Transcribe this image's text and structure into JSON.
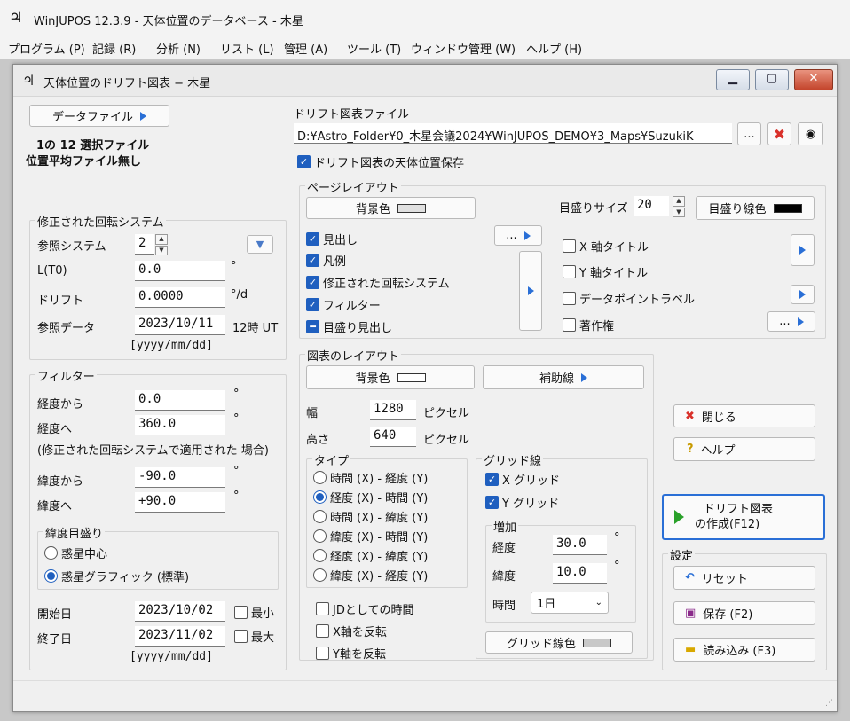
{
  "app": {
    "title": "WinJUPOS 12.3.9 - 天体位置のデータベース - 木星",
    "icon": "jupiter-symbol-icon"
  },
  "menu": [
    "プログラム (P)",
    "記録 (R)",
    "分析 (N)",
    "リスト (L)",
    "管理 (A)",
    "ツール (T)",
    "ウィンドウ管理 (W)",
    "ヘルプ (H)"
  ],
  "window": {
    "title": "天体位置のドリフト図表 − 木星"
  },
  "left": {
    "data_file_btn": "データファイル",
    "selection_info": "1の 12 選択ファイル",
    "avg_info": "位置平均ファイル無し",
    "rot": {
      "title": "修正された回転システム",
      "ref_system_label": "参照システム",
      "ref_system_value": "2",
      "lt0_label": "L(T0)",
      "lt0_value": "0.0",
      "lt0_unit": "°",
      "drift_label": "ドリフト",
      "drift_value": "0.0000",
      "drift_unit": "°/d",
      "ref_date_label": "参照データ",
      "ref_date_value": "2023/10/11",
      "ref_time": "12時 UT",
      "date_format": "[yyyy/mm/dd]"
    },
    "filter": {
      "title": "フィルター",
      "lon_from_label": "経度から",
      "lon_from": "0.0",
      "lon_to_label": "経度へ",
      "lon_to": "360.0",
      "deg": "°",
      "note": "(修正された回転システムで適用された 場合)",
      "lat_from_label": "緯度から",
      "lat_from": "-90.0",
      "lat_to_label": "緯度へ",
      "lat_to": "+90.0",
      "lat_scale": {
        "title": "緯度目盛り",
        "options": [
          "惑星中心",
          "惑星グラフィック (標準)"
        ],
        "selected": 1
      }
    },
    "start_label": "開始日",
    "start_value": "2023/10/02",
    "min_label": "最小",
    "end_label": "終了日",
    "end_value": "2023/11/02",
    "max_label": "最大",
    "date_format": "[yyyy/mm/dd]"
  },
  "drift_file": {
    "label": "ドリフト図表ファイル",
    "path": "D:¥Astro_Folder¥0_木星会議2024¥WinJUPOS_DEMO¥3_Maps¥SuzukiK",
    "browse_btn": "...",
    "save_positions_label": "ドリフト図表の天体位置保存"
  },
  "page_layout": {
    "title": "ページレイアウト",
    "bg_btn": "背景色",
    "scale_size_label": "目盛りサイズ",
    "scale_size_value": "20",
    "scale_line_color_btn": "目盛り線色",
    "checks": [
      {
        "label": "見出し",
        "state": "on"
      },
      {
        "label": "凡例",
        "state": "on"
      },
      {
        "label": "修正された回転システム",
        "state": "on"
      },
      {
        "label": "フィルター",
        "state": "on"
      },
      {
        "label": "目盛り見出し",
        "state": "partial"
      }
    ],
    "more_btn": "...",
    "right_checks": [
      {
        "label": "X 軸タイトル",
        "state": "off"
      },
      {
        "label": "Y 軸タイトル",
        "state": "off"
      },
      {
        "label": "データポイントラベル",
        "state": "off"
      },
      {
        "label": "著作権",
        "state": "off"
      }
    ],
    "more_btn2": "..."
  },
  "chart_layout": {
    "title": "図表のレイアウト",
    "bg_btn": "背景色",
    "aux_btn": "補助線",
    "width_label": "幅",
    "width_value": "1280",
    "height_label": "高さ",
    "height_value": "640",
    "px_unit": "ピクセル",
    "type": {
      "title": "タイプ",
      "options": [
        "時間 (X) - 経度 (Y)",
        "経度 (X) - 時間 (Y)",
        "時間 (X) - 緯度 (Y)",
        "緯度 (X) - 時間 (Y)",
        "経度 (X) - 緯度 (Y)",
        "緯度 (X) - 経度 (Y)"
      ],
      "selected": 1
    },
    "grid": {
      "title": "グリッド線",
      "x_grid": "X グリッド",
      "y_grid": "Y グリッド",
      "incr": {
        "title": "増加",
        "lon_label": "経度",
        "lon_value": "30.0",
        "lat_label": "緯度",
        "lat_value": "10.0",
        "time_label": "時間",
        "time_value": "1日",
        "deg": "°"
      },
      "color_btn": "グリッド線色"
    },
    "jd_time": "JDとしての時間",
    "flip_x": "X軸を反転",
    "flip_y": "Y軸を反転"
  },
  "actions": {
    "close_btn": "閉じる",
    "help_btn": "ヘルプ",
    "create_line1": "ドリフト図表",
    "create_line2": "の作成(F12)",
    "settings_title": "設定",
    "reset_btn": "リセット",
    "save_btn": "保存 (F2)",
    "load_btn": "読み込み (F3)"
  },
  "colors": {
    "checkbox_blue": "#1f5fbf",
    "arrow_blue": "#2a6fd6",
    "close_red": "#d9312b",
    "play_green": "#2aa12a"
  }
}
